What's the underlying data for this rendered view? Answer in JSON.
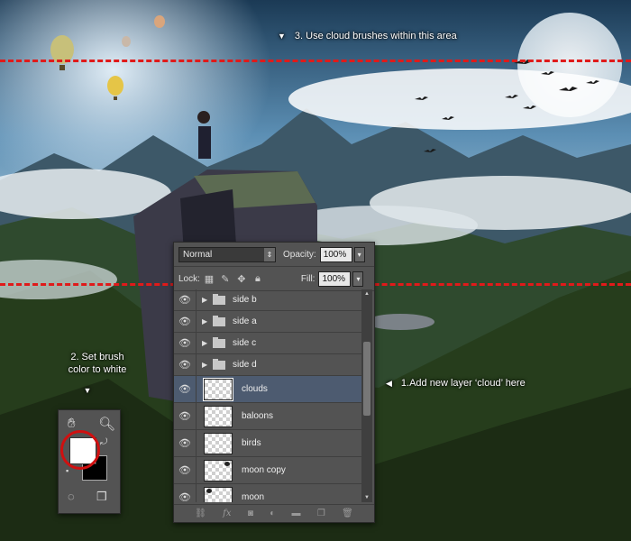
{
  "annotations": {
    "top_note": "3. Use cloud brushes within this area",
    "left_note_line1": "2. Set brush",
    "left_note_line2": "color to white",
    "right_note": "1.Add new layer ‘cloud’ here",
    "dash_color": "#e01a1a"
  },
  "layers_panel": {
    "blend_mode": "Normal",
    "opacity_label": "Opacity:",
    "opacity_value": "100%",
    "lock_label": "Lock:",
    "fill_label": "Fill:",
    "fill_value": "100%",
    "layers": [
      {
        "name": "side b",
        "type": "group",
        "active": false
      },
      {
        "name": "side a",
        "type": "group",
        "active": false
      },
      {
        "name": "side c",
        "type": "group",
        "active": false
      },
      {
        "name": "side d",
        "type": "group",
        "active": false
      },
      {
        "name": "clouds",
        "type": "layer",
        "active": true
      },
      {
        "name": "baloons",
        "type": "layer",
        "active": false
      },
      {
        "name": "birds",
        "type": "layer",
        "active": false
      },
      {
        "name": "moon copy",
        "type": "layer",
        "active": false
      },
      {
        "name": "moon",
        "type": "layer",
        "active": false
      }
    ],
    "footer_icons": [
      "link-icon",
      "fx-icon",
      "mask-icon",
      "adjustment-icon",
      "folder-icon",
      "new-layer-icon",
      "trash-icon"
    ],
    "footer_fx": "fx"
  },
  "tools": {
    "foreground_color": "#ffffff",
    "background_color": "#000000",
    "highlight_color": "#d01010"
  }
}
